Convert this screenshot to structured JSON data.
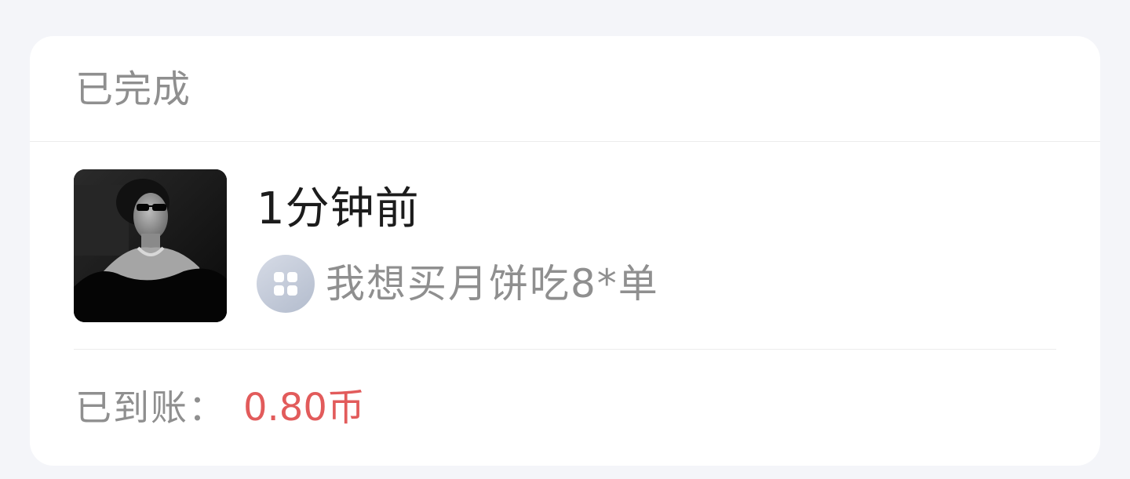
{
  "status": {
    "title": "已完成"
  },
  "order": {
    "time_ago": "1分钟前",
    "task": {
      "icon": "app-grid-icon",
      "text": "我想买月饼吃8*单"
    }
  },
  "payout": {
    "label": "已到账：",
    "amount": "0.80币",
    "amount_color": "#e25b5b"
  }
}
